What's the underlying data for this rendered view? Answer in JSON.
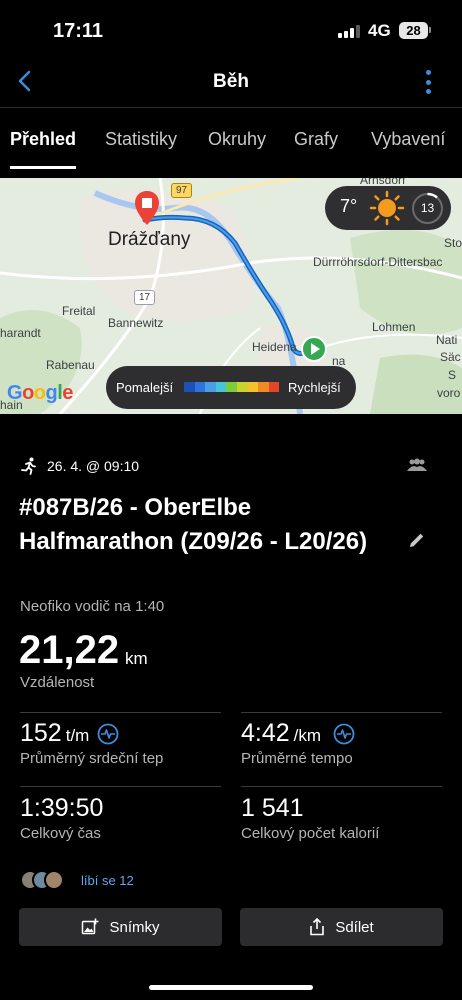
{
  "status_bar": {
    "time": "17:11",
    "network": "4G",
    "battery": "28"
  },
  "header": {
    "title": "Běh"
  },
  "tabs": [
    {
      "label": "Přehled",
      "active": true
    },
    {
      "label": "Statistiky"
    },
    {
      "label": "Okruhy"
    },
    {
      "label": "Grafy"
    },
    {
      "label": "Vybavení"
    }
  ],
  "map": {
    "places": {
      "city": "Drážďany",
      "freital": "Freital",
      "bannewitz": "Bannewitz",
      "heidenau": "Heidena",
      "lohmen": "Lohmen",
      "durrrohrsdorf": "Dürrröhrsdorf-Dittersbac",
      "rabenau": "Rabenau",
      "tharandt": "harandt",
      "chain": "hain",
      "stolpen": "Sto",
      "arnsdorf": "Arnsdorf",
      "nati": "Nati",
      "sac": "Säc",
      "s": "S",
      "voro": "voro",
      "pirna": "na"
    },
    "road_shields": {
      "b97": "97",
      "a17": "17"
    },
    "weather": {
      "temperature": "7°",
      "icon": "sun-icon",
      "index": "13"
    },
    "legend": {
      "slow_label": "Pomalejší",
      "fast_label": "Rychlejší",
      "colors": [
        "#1f4fb8",
        "#2f74d8",
        "#4a9ee8",
        "#48c3d9",
        "#7ccc3c",
        "#c6d330",
        "#f2c12e",
        "#f08a24",
        "#e3452a"
      ]
    },
    "attribution": "Google"
  },
  "activity": {
    "type_icon": "running-icon",
    "date": "26. 4. @ 09:10",
    "title": "#087B/26 - OberElbe Halfmarathon (Z09/26 - L20/26)",
    "subtitle": "Neofiko vodič na 1:40",
    "distance": {
      "value": "21,22",
      "unit": "km",
      "label": "Vzdálenost"
    }
  },
  "stats": {
    "avg_hr": {
      "value": "152",
      "unit": "t/m",
      "label": "Průměrný srdeční tep"
    },
    "avg_pace": {
      "value": "4:42",
      "unit": "/km",
      "label": "Průměrné tempo"
    },
    "total_time": {
      "value": "1:39:50",
      "label": "Celkový čas"
    },
    "calories": {
      "value": "1 541",
      "label": "Celkový počet kalorií"
    }
  },
  "social": {
    "likes_text": "líbí se 12"
  },
  "buttons": {
    "photos": "Snímky",
    "share": "Sdílet"
  },
  "colors": {
    "accent": "#3d8ddb",
    "route": "#1565c0",
    "likes": "#5aa9f0",
    "start": "#34a853",
    "end": "#ea4335"
  }
}
